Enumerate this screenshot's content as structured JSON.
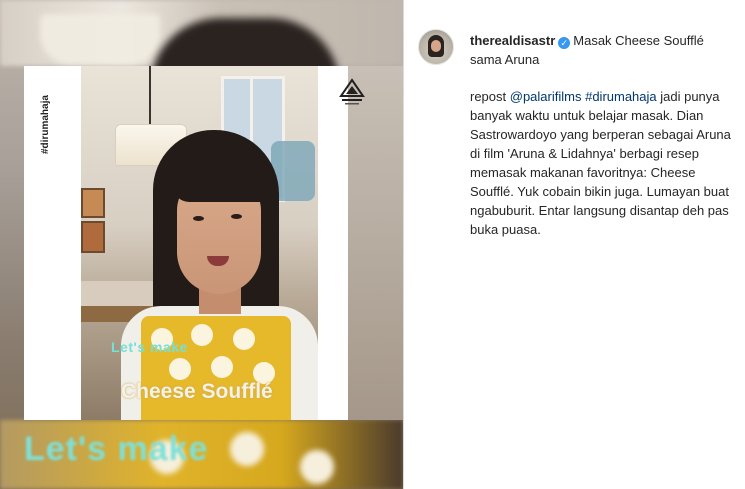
{
  "media": {
    "side_hashtag": "#dirumahaja",
    "caption_line1": "Let's make",
    "caption_line2": "Cheese Soufflé",
    "blurred_caption": "Let's make",
    "logo": "palari-films-logo"
  },
  "post": {
    "username": "therealdisastr",
    "verified_icon": "verified-badge-icon",
    "title": "Masak Cheese Soufflé sama Aruna",
    "body": {
      "prefix": "repost ",
      "mention": "@palarifilms",
      "hashtag": "#dirumahaja",
      "text": " jadi punya banyak waktu untuk belajar masak. Dian Sastrowardoyo yang berperan sebagai Aruna di film 'Aruna & Lidahnya' berbagi resep memasak makanan favoritnya: Cheese Soufflé. Yuk cobain bikin juga. Lumayan buat ngabuburit. Entar langsung disantap deh pas buka puasa."
    }
  },
  "colors": {
    "link": "#00376b",
    "verified": "#3897f0",
    "caption_teal": "#74e0d6",
    "apron_yellow": "#e6b92b"
  }
}
